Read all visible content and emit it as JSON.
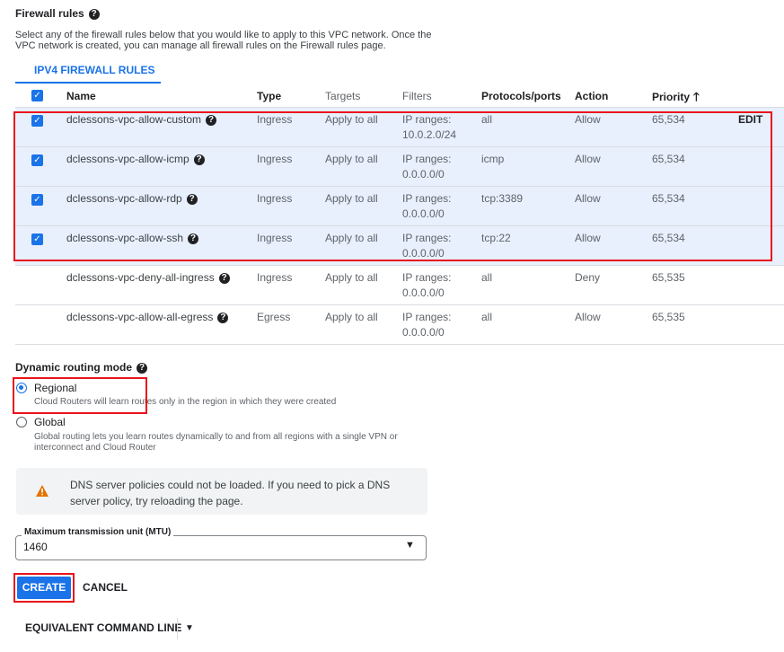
{
  "firewall": {
    "title": "Firewall rules",
    "description": "Select any of the firewall rules below that you would like to apply to this VPC network. Once the VPC network is created, you can manage all firewall rules on the Firewall rules page.",
    "tab": "IPV4 FIREWALL RULES",
    "columns": {
      "name": "Name",
      "type": "Type",
      "targets": "Targets",
      "filters": "Filters",
      "protocols": "Protocols/ports",
      "action": "Action",
      "priority": "Priority"
    },
    "edit_label": "EDIT",
    "rows": [
      {
        "name": "dclessons-vpc-allow-custom",
        "type": "Ingress",
        "targets": "Apply to all",
        "filters": "IP ranges: 10.0.2.0/24",
        "protocols": "all",
        "action": "Allow",
        "priority": "65,534",
        "checked": true
      },
      {
        "name": "dclessons-vpc-allow-icmp",
        "type": "Ingress",
        "targets": "Apply to all",
        "filters": "IP ranges: 0.0.0.0/0",
        "protocols": "icmp",
        "action": "Allow",
        "priority": "65,534",
        "checked": true
      },
      {
        "name": "dclessons-vpc-allow-rdp",
        "type": "Ingress",
        "targets": "Apply to all",
        "filters": "IP ranges: 0.0.0.0/0",
        "protocols": "tcp:3389",
        "action": "Allow",
        "priority": "65,534",
        "checked": true
      },
      {
        "name": "dclessons-vpc-allow-ssh",
        "type": "Ingress",
        "targets": "Apply to all",
        "filters": "IP ranges: 0.0.0.0/0",
        "protocols": "tcp:22",
        "action": "Allow",
        "priority": "65,534",
        "checked": true
      },
      {
        "name": "dclessons-vpc-deny-all-ingress",
        "type": "Ingress",
        "targets": "Apply to all",
        "filters": "IP ranges: 0.0.0.0/0",
        "protocols": "all",
        "action": "Deny",
        "priority": "65,535",
        "checked": false
      },
      {
        "name": "dclessons-vpc-allow-all-egress",
        "type": "Egress",
        "targets": "Apply to all",
        "filters": "IP ranges: 0.0.0.0/0",
        "protocols": "all",
        "action": "Allow",
        "priority": "65,535",
        "checked": false
      }
    ]
  },
  "routing": {
    "title": "Dynamic routing mode",
    "options": [
      {
        "label": "Regional",
        "desc": "Cloud Routers will learn routes only in the region in which they were created",
        "selected": true
      },
      {
        "label": "Global",
        "desc": "Global routing lets you learn routes dynamically to and from all regions with a single VPN or interconnect and Cloud Router",
        "selected": false
      }
    ]
  },
  "dns_warning": "DNS server policies could not be loaded. If you need to pick a DNS server policy, try reloading the page.",
  "mtu": {
    "label": "Maximum transmission unit (MTU)",
    "value": "1460"
  },
  "actions": {
    "create": "CREATE",
    "cancel": "CANCEL",
    "command_line": "EQUIVALENT COMMAND LINE"
  },
  "colors": {
    "accent": "#1a73e8",
    "highlight": "#e8141c",
    "warning": "#e37400"
  },
  "icons": {
    "help": "?",
    "sort_up": "🡑",
    "check": "✓",
    "dropdown": "▼"
  }
}
